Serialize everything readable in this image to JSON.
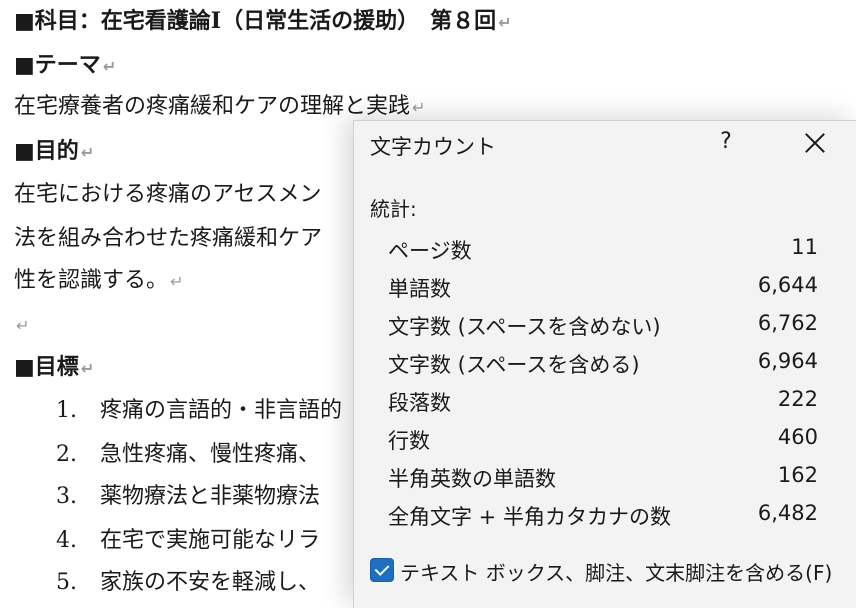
{
  "document": {
    "heading": "■科目：在宅看護論Ⅰ（日常生活の援助）　第８回",
    "theme_heading": "■テーマ",
    "theme_text": "在宅療養者の疼痛緩和ケアの理解と実践",
    "purpose_heading": "■目的",
    "purpose_line1": "在宅における疼痛のアセスメン",
    "purpose_line2": "法を組み合わせた疼痛緩和ケア",
    "purpose_line3": "性を認識する。",
    "goals_heading": "■目標",
    "goals": [
      {
        "num": "1.",
        "text": "疼痛の言語的・非言語的"
      },
      {
        "num": "2.",
        "text": "急性疼痛、慢性疼痛、"
      },
      {
        "num": "3.",
        "text": "薬物療法と非薬物療法"
      },
      {
        "num": "4.",
        "text": "在宅で実施可能なリラ"
      },
      {
        "num": "5.",
        "text": "家族の不安を軽減し、"
      }
    ],
    "para_mark": "↵"
  },
  "dialog": {
    "title": "文字カウント",
    "help": "?",
    "stats_label": "統計:",
    "stats": [
      {
        "label": "ページ数",
        "value": "11"
      },
      {
        "label": "単語数",
        "value": "6,644"
      },
      {
        "label": "文字数 (スペースを含めない)",
        "value": "6,762"
      },
      {
        "label": "文字数 (スペースを含める)",
        "value": "6,964"
      },
      {
        "label": "段落数",
        "value": "222"
      },
      {
        "label": "行数",
        "value": "460"
      },
      {
        "label": "半角英数の単語数",
        "value": "162"
      },
      {
        "label": "全角文字 + 半角カタカナの数",
        "value": "6,482"
      }
    ],
    "include_textboxes_label": "テキスト ボックス、脚注、文末脚注を含める(F)",
    "include_textboxes_checked": true,
    "accent_color": "#1e6fc2"
  }
}
